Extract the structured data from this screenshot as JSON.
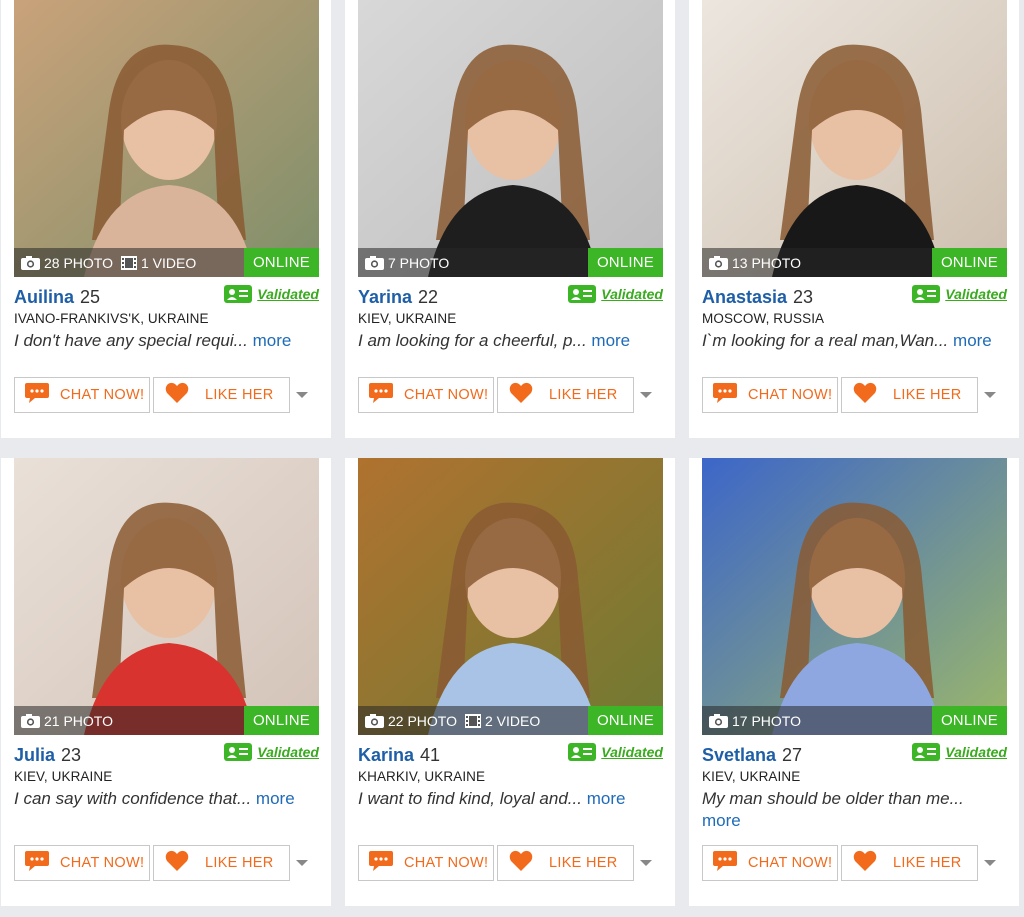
{
  "ui": {
    "online_label": "ONLINE",
    "validated_label": "Validated",
    "more_label": "more",
    "chat_label": "CHAT NOW!",
    "like_label": "LIKE HER",
    "colors": {
      "accent": "#f26a1b",
      "online": "#3cb526",
      "name": "#1f5fa8",
      "link": "#1f6bb8"
    }
  },
  "profiles": [
    {
      "name": "Auilina",
      "age": "25",
      "photo_count": "28 PHOTO",
      "video_count": "1 VIDEO",
      "location": "IVANO-FRANKIVS'K, UKRAINE",
      "bio": "I don't have any special requi..."
    },
    {
      "name": "Yarina",
      "age": "22",
      "photo_count": "7 PHOTO",
      "video_count": "",
      "location": "KIEV, UKRAINE",
      "bio": "I am looking for a cheerful, p..."
    },
    {
      "name": "Anastasia",
      "age": "23",
      "photo_count": "13 PHOTO",
      "video_count": "",
      "location": "MOSCOW, RUSSIA",
      "bio": "I`m looking for a real man,Wan..."
    },
    {
      "name": "Julia",
      "age": "23",
      "photo_count": "21 PHOTO",
      "video_count": "",
      "location": "KIEV, UKRAINE",
      "bio": "I can say with confidence that..."
    },
    {
      "name": "Karina",
      "age": "41",
      "photo_count": "22 PHOTO",
      "video_count": "2 VIDEO",
      "location": "KHARKIV, UKRAINE",
      "bio": "I want to find kind, loyal and..."
    },
    {
      "name": "Svetlana",
      "age": "27",
      "photo_count": "17 PHOTO",
      "video_count": "",
      "location": "KIEV, UKRAINE",
      "bio": "My man should be older than me..."
    }
  ]
}
